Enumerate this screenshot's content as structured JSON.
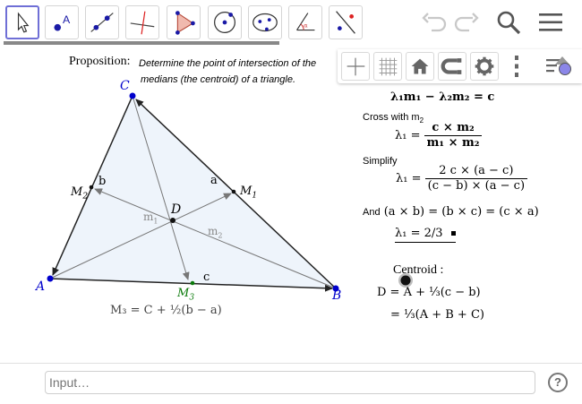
{
  "input_bar": {
    "placeholder": "Input…",
    "help_label": "?"
  },
  "construction": {
    "heading": "Proposition:",
    "statement_line1": "Determine the point of intersection of the",
    "statement_line2": "medians (the centroid) of a triangle.",
    "points": {
      "A": "A",
      "B": "B",
      "C": "C",
      "D": "D",
      "M1": "M",
      "M2": "M",
      "M3": "M"
    },
    "point_subscripts": {
      "M1": "1",
      "M2": "2",
      "M3": "3"
    },
    "side_labels": {
      "a": "a",
      "b": "b",
      "c": "c"
    },
    "median_labels": {
      "m1": "m",
      "m2": "m",
      "sub1": "1",
      "sub2": "2"
    },
    "m3_formula": "M₃ = C + ½(b − a)"
  },
  "derivation": {
    "line0": "λ₁m₁ − λ₂m₂ = c",
    "cross_note": "Cross with m",
    "cross_sub": "2",
    "lambda_label": "λ₁ =",
    "frac1_num": "c × m₂",
    "frac1_den": "m₁ × m₂",
    "simplify_note": "Simplify",
    "frac2_num": "2 c × (a − c)",
    "frac2_den": "(c − b) × (a − c)",
    "and_note": "And",
    "and_formula": "(a × b) = (b × c) = (c × a)",
    "result": "λ₁ = 2/3",
    "centroid_label": "Centroid :",
    "d_formula": "D = A + ⅓(c − b)",
    "d_formula2": "= ⅓(A + B + C)"
  },
  "colors": {
    "accent": "#6f6fd6",
    "triangle_fill": "#eef4fb",
    "point": "#0000cc",
    "label_blue": "#0000cc"
  }
}
